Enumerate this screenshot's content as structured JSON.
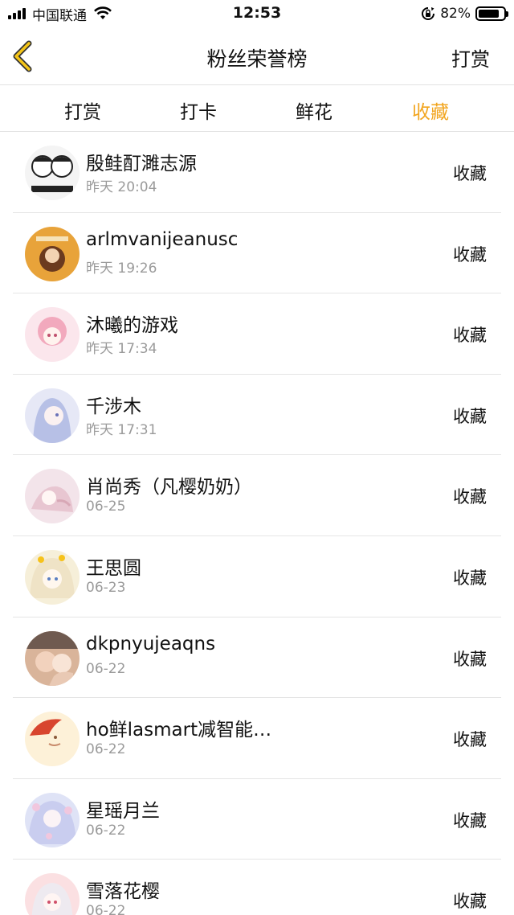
{
  "status_bar": {
    "carrier": "中国联通",
    "time": "12:53",
    "battery": "82%",
    "battery_level": 0.82
  },
  "nav": {
    "title": "粉丝荣誉榜",
    "right_label": "打赏",
    "back_icon": "chevron-left-icon"
  },
  "tabs": [
    {
      "label": "打赏",
      "active": false
    },
    {
      "label": "打卡",
      "active": false
    },
    {
      "label": "鲜花",
      "active": false
    },
    {
      "label": "收藏",
      "active": true
    }
  ],
  "accent_color": "#f2a51f",
  "list": [
    {
      "name": "殷鲑酊濉志源",
      "time": "昨天 20:04",
      "action": "收藏"
    },
    {
      "name": "arlmvanijeanusc",
      "time": "昨天 19:26",
      "action": "收藏"
    },
    {
      "name": "沐曦的游戏",
      "time": "昨天 17:34",
      "action": "收藏"
    },
    {
      "name": "千涉木",
      "time": "昨天 17:31",
      "action": "收藏"
    },
    {
      "name": "肖尚秀（凡樱奶奶）",
      "time": "06-25",
      "action": "收藏"
    },
    {
      "name": "王思圆",
      "time": "06-23",
      "action": "收藏"
    },
    {
      "name": "dkpnyujeaqns",
      "time": "06-22",
      "action": "收藏"
    },
    {
      "name": "ho鲜lasmart减智能…",
      "time": "06-22",
      "action": "收藏"
    },
    {
      "name": "星瑶月兰",
      "time": "06-22",
      "action": "收藏"
    },
    {
      "name": "雪落花樱",
      "time": "06-22",
      "action": "收藏"
    }
  ]
}
